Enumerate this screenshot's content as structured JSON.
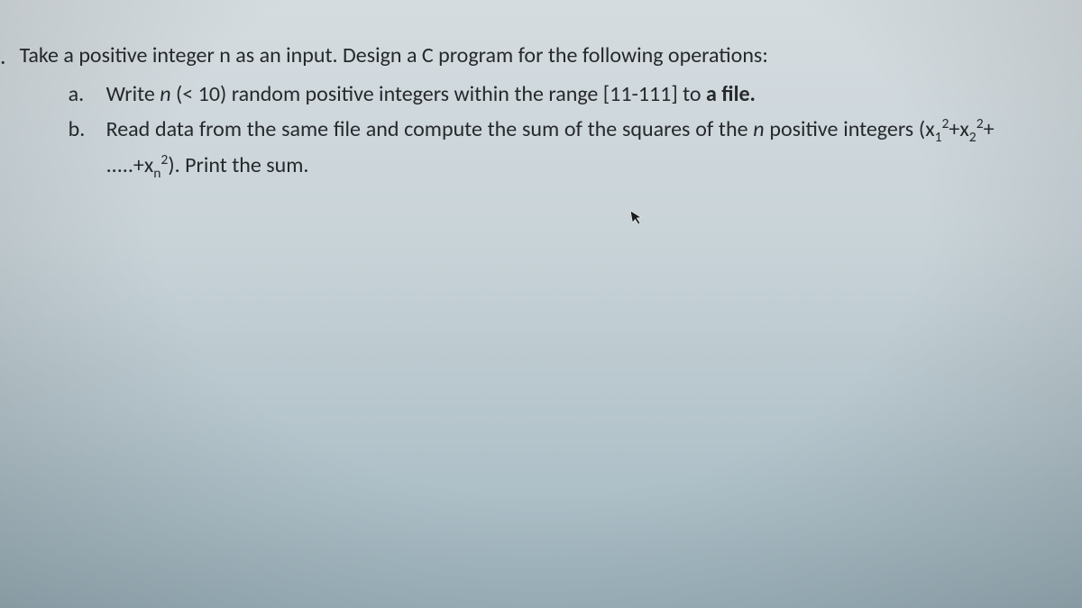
{
  "question": {
    "bullet": ".",
    "main": "Take a positive integer n as an input. Design a C program for the following operations:",
    "items": [
      {
        "label": "a.",
        "text_parts": {
          "prefix": "Write ",
          "var": "n",
          "mid": " (< 10) random positive integers within the range [11-111] to ",
          "bold": "a file.",
          "suffix": ""
        }
      },
      {
        "label": "b.",
        "text_parts": {
          "line1_prefix": "Read data from the same file and compute the sum of the squares of the ",
          "line1_var": "n",
          "line1_suffix": " positive",
          "line2_prefix": "integers (x",
          "sub1": "1",
          "sup1": "2",
          "plus1": "+x",
          "sub2": "2",
          "sup2": "2",
          "plus2": "+ .....+x",
          "subn": "n",
          "supn": "2",
          "line2_suffix": "). Print the sum."
        }
      }
    ]
  }
}
